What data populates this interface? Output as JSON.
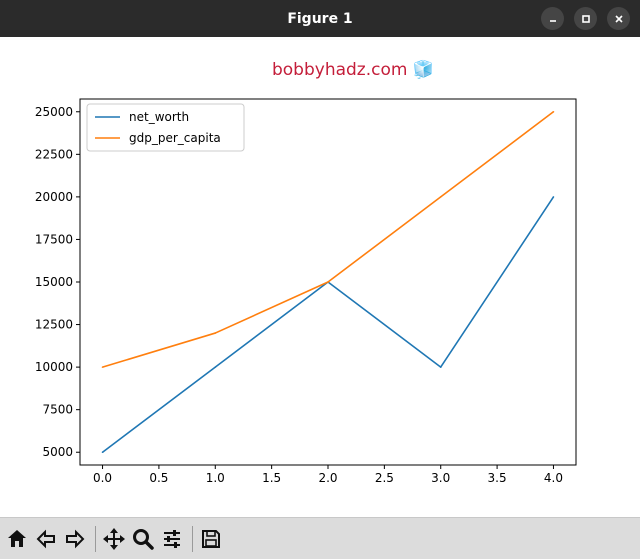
{
  "window": {
    "title": "Figure 1",
    "controls": [
      "minimize-icon",
      "maximize-icon",
      "close-icon"
    ]
  },
  "toolbar": {
    "tools": [
      "home-icon",
      "back-icon",
      "forward-icon",
      "pan-icon",
      "zoom-icon",
      "configure-subplots-icon",
      "save-icon"
    ]
  },
  "chart_data": {
    "type": "line",
    "title": "bobbyhadz.com 🧊",
    "title_color": "#c41e3a",
    "xlabel": "",
    "ylabel": "",
    "x": [
      0,
      1,
      2,
      3,
      4
    ],
    "xlim": [
      -0.2,
      4.2
    ],
    "ylim": [
      4250,
      25750
    ],
    "xticks": [
      "0.0",
      "0.5",
      "1.0",
      "1.5",
      "2.0",
      "2.5",
      "3.0",
      "3.5",
      "4.0"
    ],
    "xtick_values": [
      0,
      0.5,
      1,
      1.5,
      2,
      2.5,
      3,
      3.5,
      4
    ],
    "yticks": [
      "5000",
      "7500",
      "10000",
      "12500",
      "15000",
      "17500",
      "20000",
      "22500",
      "25000"
    ],
    "ytick_values": [
      5000,
      7500,
      10000,
      12500,
      15000,
      17500,
      20000,
      22500,
      25000
    ],
    "grid": false,
    "legend_position": "top-left",
    "series": [
      {
        "name": "net_worth",
        "color": "#1f77b4",
        "values": [
          5000,
          10000,
          15000,
          10000,
          20000
        ]
      },
      {
        "name": "gdp_per_capita",
        "color": "#ff7f0e",
        "values": [
          10000,
          12000,
          15000,
          20000,
          25000
        ]
      }
    ]
  }
}
